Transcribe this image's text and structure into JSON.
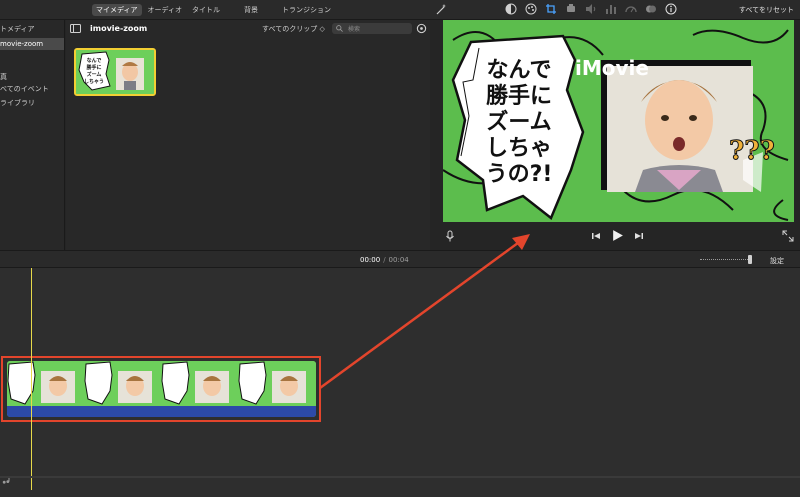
{
  "toolbar": {
    "tabs": [
      "マイメディア",
      "オーディオ",
      "タイトル",
      "背景",
      "トランジション"
    ],
    "reset_label": "すべてをリセット"
  },
  "sidebar": {
    "library_header": "トメディア",
    "selected_item": "movie-zoom",
    "items": [
      "真",
      "べてのイベント",
      "ライブラリ"
    ]
  },
  "browser": {
    "title": "imovie-zoom",
    "filter": "すべてのクリップ ◇",
    "search_placeholder": "検索"
  },
  "viewer": {
    "overlay_title": "iMovie",
    "bubble_lines": [
      "なんで",
      "勝手に",
      "ズーム",
      "しちゃ",
      "うの?!"
    ],
    "question_marks": "???"
  },
  "timeline": {
    "timecode_current": "00:00",
    "timecode_separator": "/",
    "timecode_total": "00:04",
    "settings_label": "設定"
  },
  "colors": {
    "clip_green": "#6dcf5b",
    "audio_blue": "#2c4aa8",
    "highlight_red": "#e3452c",
    "playhead_yellow": "#e6d94a",
    "selection_yellow": "#f2cf33"
  }
}
